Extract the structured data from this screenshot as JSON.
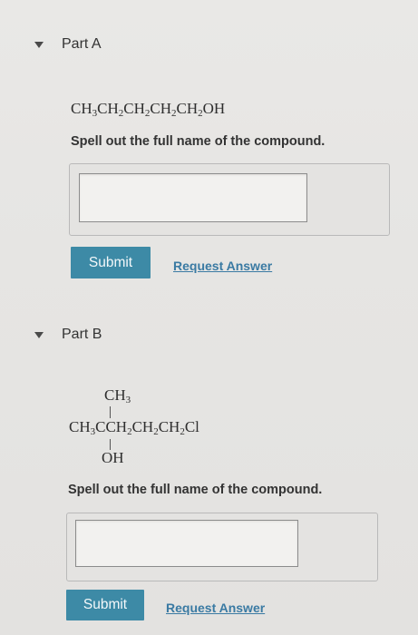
{
  "partA": {
    "title": "Part A",
    "formula": {
      "segments": [
        {
          "t": "CH",
          "s": "3"
        },
        {
          "t": "CH",
          "s": "2"
        },
        {
          "t": "CH",
          "s": "2"
        },
        {
          "t": "CH",
          "s": "2"
        },
        {
          "t": "CH",
          "s": "2"
        },
        {
          "t": "OH",
          "s": ""
        }
      ]
    },
    "prompt": "Spell out the full name of the compound.",
    "answer_value": "",
    "submit_label": "Submit",
    "request_label": "Request Answer"
  },
  "partB": {
    "title": "Part B",
    "formula_top": {
      "t": "CH",
      "s": "3"
    },
    "formula_main": {
      "segments": [
        {
          "t": "CH",
          "s": "3"
        },
        {
          "t": "C",
          "s": ""
        },
        {
          "t": "CH",
          "s": "2"
        },
        {
          "t": "CH",
          "s": "2"
        },
        {
          "t": "CH",
          "s": "2"
        },
        {
          "t": "Cl",
          "s": ""
        }
      ]
    },
    "formula_bottom": "OH",
    "prompt": "Spell out the full name of the compound.",
    "answer_value": "",
    "submit_label": "Submit",
    "request_label": "Request Answer"
  },
  "icons": {
    "expand": "caret-down-icon"
  }
}
